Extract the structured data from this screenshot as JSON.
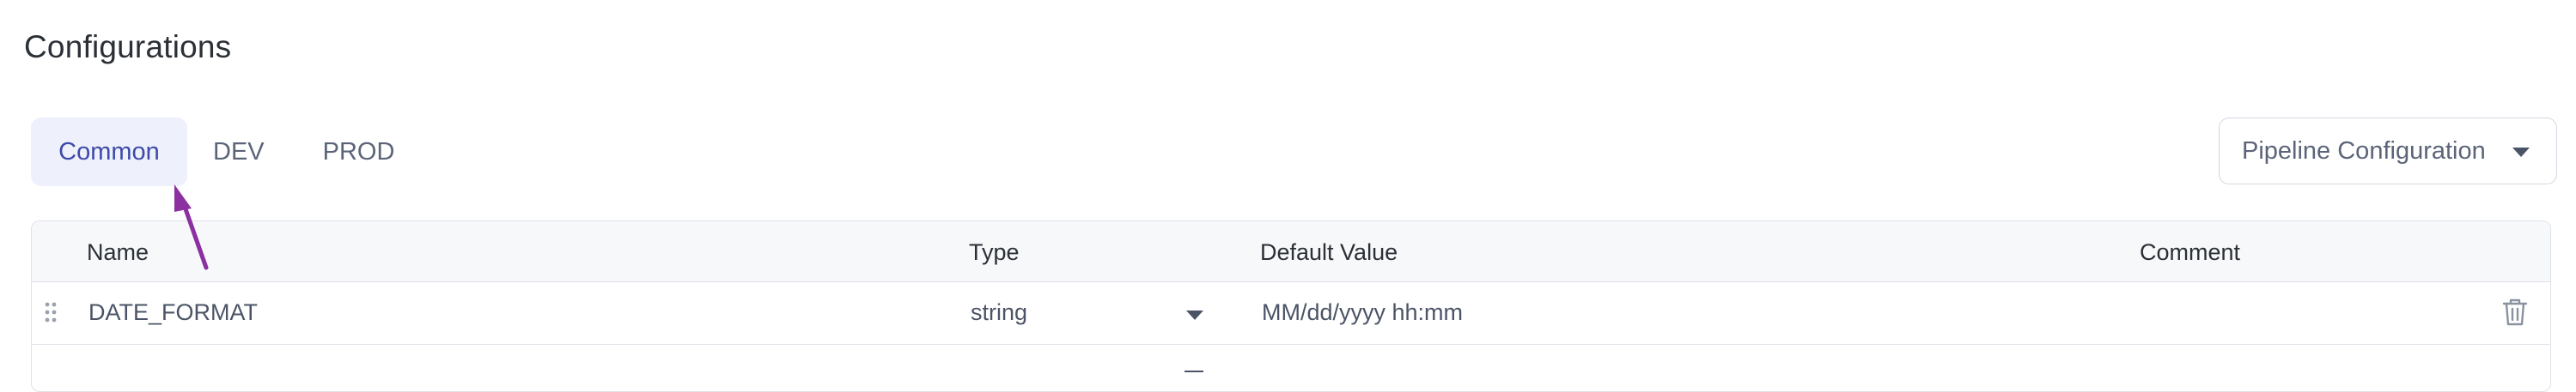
{
  "page": {
    "title": "Configurations"
  },
  "tabs": [
    {
      "label": "Common",
      "active": true
    },
    {
      "label": "DEV",
      "active": false
    },
    {
      "label": "PROD",
      "active": false
    }
  ],
  "config_select": {
    "value": "Pipeline Configuration",
    "icon": "chevron-down-icon"
  },
  "table": {
    "headers": [
      "Name",
      "Type",
      "Default Value",
      "Comment"
    ],
    "rows": [
      {
        "name": "DATE_FORMAT",
        "type": "string",
        "default_value": "MM/dd/yyyy hh:mm",
        "comment": ""
      }
    ]
  },
  "annotation": {
    "color": "#8b2fa1"
  }
}
